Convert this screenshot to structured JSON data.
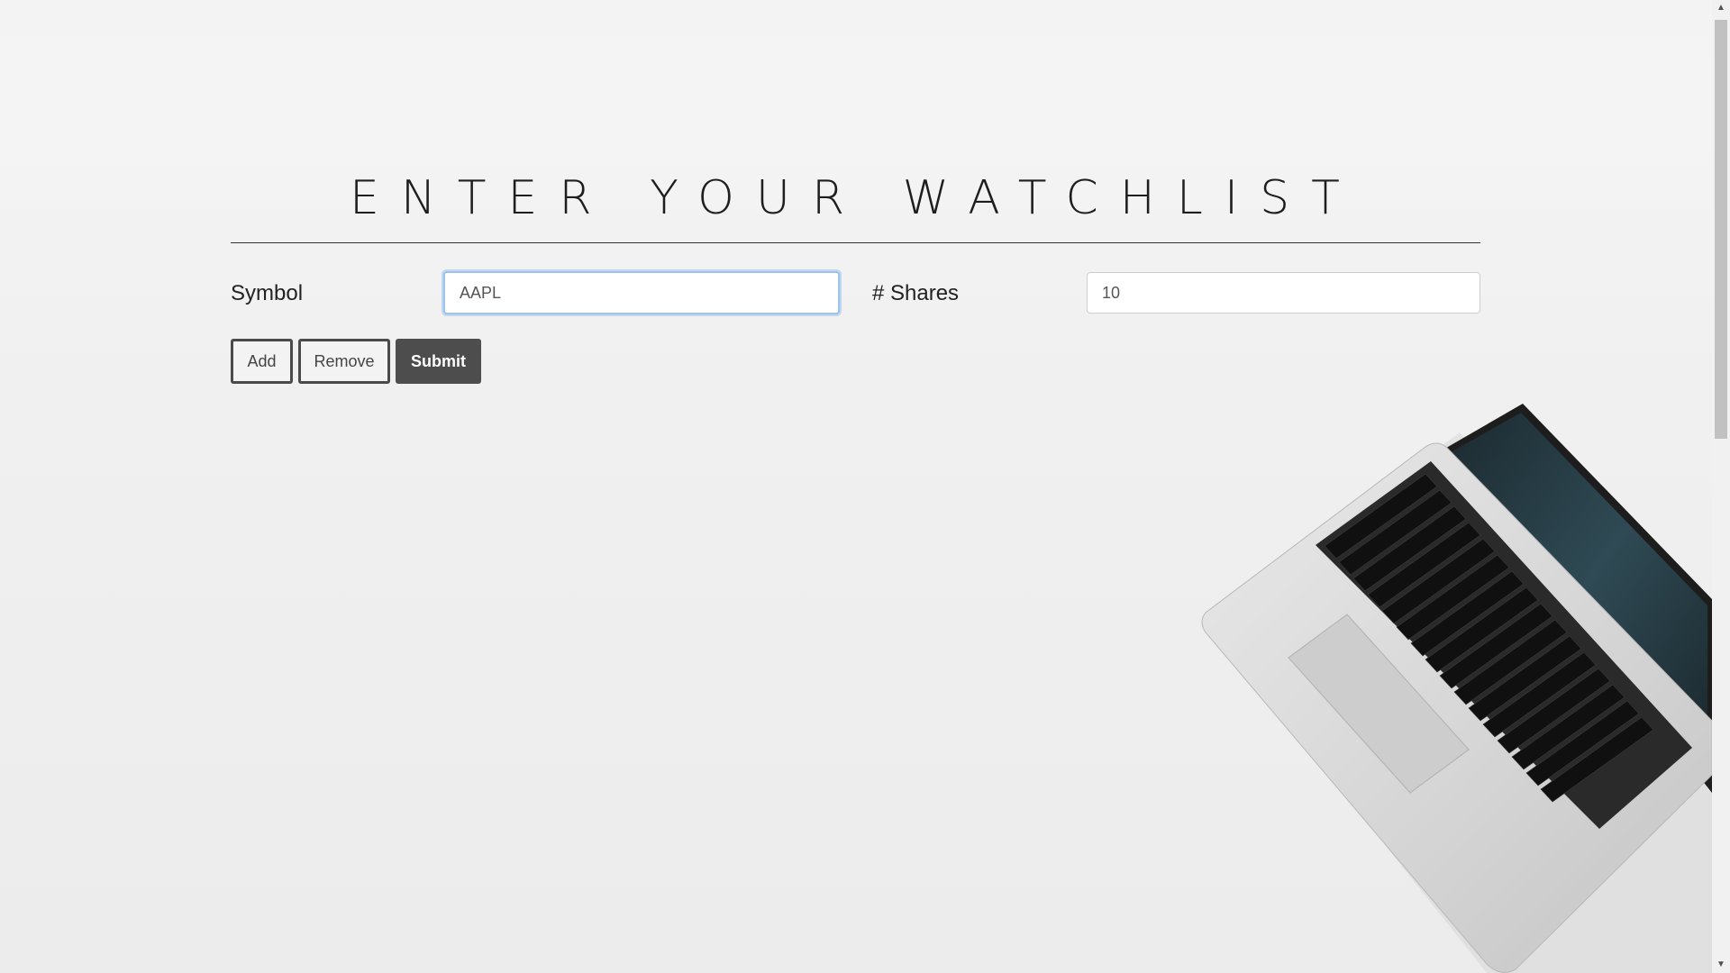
{
  "header": {
    "title": "ENTER YOUR WATCHLIST"
  },
  "form": {
    "symbol_label": "Symbol",
    "symbol_value": "AAPL",
    "shares_label": "# Shares",
    "shares_value": "10"
  },
  "actions": {
    "add_label": "Add",
    "remove_label": "Remove",
    "submit_label": "Submit"
  },
  "scrollbar": {
    "up_arrow_icon": "triangle-up",
    "down_arrow_icon": "triangle-down"
  },
  "decor": {
    "image": "laptop-photo",
    "submit_color": "#4d4d4d",
    "focus_color": "#9ec3ee"
  }
}
